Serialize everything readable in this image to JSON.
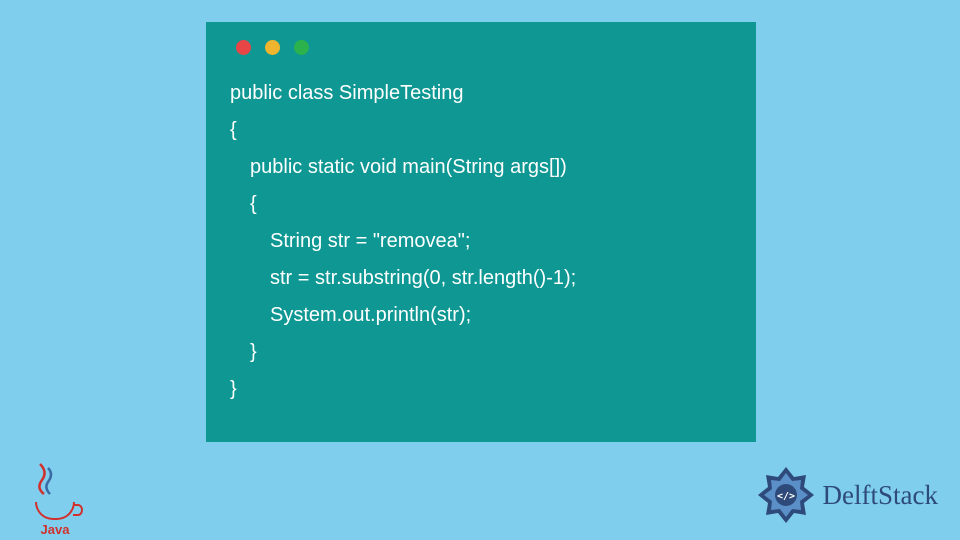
{
  "code": {
    "lines": [
      "public class SimpleTesting",
      "{ ",
      " public static void main(String args[])",
      " {",
      "  String str = \"removea\";",
      "  str = str.substring(0, str.length()-1);",
      "  System.out.println(str);",
      " }",
      "}"
    ]
  },
  "java_logo": {
    "text": "Java"
  },
  "delftstack": {
    "text": "DelftStack"
  }
}
